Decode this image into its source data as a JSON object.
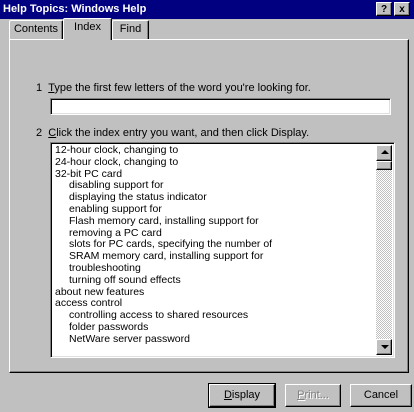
{
  "window": {
    "title": "Help Topics: Windows Help",
    "help_button": "?",
    "close_button": "x"
  },
  "tabs": [
    {
      "label": "Contents",
      "active": false
    },
    {
      "label": "Index",
      "active": true
    },
    {
      "label": "Find",
      "active": false
    }
  ],
  "step1": {
    "number": "1",
    "hotkey": "T",
    "text": "ype the first few letters of the word you're looking for.",
    "input_value": ""
  },
  "step2": {
    "number": "2",
    "hotkey": "C",
    "text": "lick the index entry you want, and then click Display."
  },
  "index_entries": [
    {
      "text": "12-hour clock, changing to",
      "level": 0
    },
    {
      "text": "24-hour clock, changing to",
      "level": 0
    },
    {
      "text": "32-bit PC card",
      "level": 0
    },
    {
      "text": "disabling support for",
      "level": 1
    },
    {
      "text": "displaying the status indicator",
      "level": 1
    },
    {
      "text": "enabling support for",
      "level": 1
    },
    {
      "text": "Flash memory card, installing support for",
      "level": 1
    },
    {
      "text": "removing a PC card",
      "level": 1
    },
    {
      "text": "slots for PC cards, specifying the number of",
      "level": 1
    },
    {
      "text": "SRAM memory card, installing support for",
      "level": 1
    },
    {
      "text": "troubleshooting",
      "level": 1
    },
    {
      "text": "turning off sound effects",
      "level": 1
    },
    {
      "text": "about new features",
      "level": 0
    },
    {
      "text": "access control",
      "level": 0
    },
    {
      "text": "controlling access to shared resources",
      "level": 1
    },
    {
      "text": "folder passwords",
      "level": 1
    },
    {
      "text": "NetWare server password",
      "level": 1
    }
  ],
  "buttons": {
    "display": {
      "hotkey": "D",
      "rest": "isplay"
    },
    "print": {
      "hotkey": "P",
      "rest": "rint..."
    },
    "cancel": "Cancel"
  }
}
